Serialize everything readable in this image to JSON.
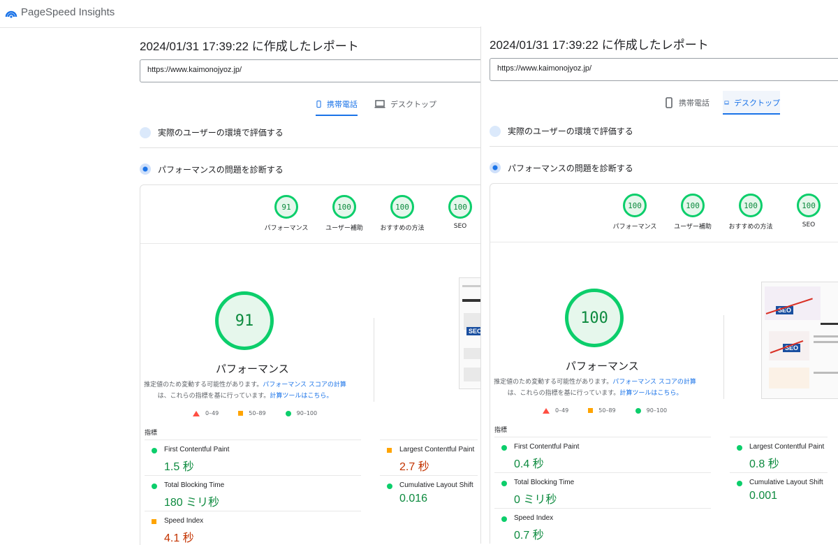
{
  "app": {
    "name": "PageSpeed Insights"
  },
  "colors": {
    "good": "#0cce6b",
    "average": "#ffa400",
    "poor": "#ff4e42",
    "accent": "#1a73e8"
  },
  "left": {
    "report_title": "2024/01/31 17:39:22 に作成したレポート",
    "url": "https://www.kaimonojyoz.jp/",
    "tabs": [
      {
        "label": "携帯電話",
        "active": true
      },
      {
        "label": "デスクトップ",
        "active": false
      }
    ],
    "sections": {
      "real_users": "実際のユーザーの環境で評価する",
      "diagnose": "パフォーマンスの問題を診断する"
    },
    "scores": [
      {
        "value": "91",
        "label": "パフォーマンス"
      },
      {
        "value": "100",
        "label": "ユーザー補助"
      },
      {
        "value": "100",
        "label": "おすすめの方法"
      },
      {
        "value": "100",
        "label": "SEO"
      }
    ],
    "main_score": "91",
    "main_label": "パフォーマンス",
    "note_line1": "推定値のため変動する可能性があります。",
    "note_link1": "パフォーマンス スコアの計算",
    "note_line2": "は、これらの指標を基に行っています。",
    "note_link2": "計算ツールはこちら。",
    "metrics_heading": "指標",
    "metrics": [
      {
        "name": "First Contentful Paint",
        "value": "1.5 秒",
        "status": "good"
      },
      {
        "name": "Largest Contentful Paint",
        "value": "2.7 秒",
        "status": "average"
      },
      {
        "name": "Total Blocking Time",
        "value": "180 ミリ秒",
        "status": "good"
      },
      {
        "name": "Cumulative Layout Shift",
        "value": "0.016",
        "status": "good"
      },
      {
        "name": "Speed Index",
        "value": "4.1 秒",
        "status": "average"
      }
    ]
  },
  "right": {
    "report_title": "2024/01/31 17:39:22 に作成したレポート",
    "url": "https://www.kaimonojyoz.jp/",
    "tabs": [
      {
        "label": "携帯電話",
        "active": false
      },
      {
        "label": "デスクトップ",
        "active": true
      }
    ],
    "sections": {
      "real_users": "実際のユーザーの環境で評価する",
      "diagnose": "パフォーマンスの問題を診断する"
    },
    "scores": [
      {
        "value": "100",
        "label": "パフォーマンス"
      },
      {
        "value": "100",
        "label": "ユーザー補助"
      },
      {
        "value": "100",
        "label": "おすすめの方法"
      },
      {
        "value": "100",
        "label": "SEO"
      }
    ],
    "main_score": "100",
    "main_label": "パフォーマンス",
    "note_line1": "推定値のため変動する可能性があります。",
    "note_link1": "パフォーマンス スコアの計算",
    "note_line2": "は、これらの指標を基に行っています。",
    "note_link2": "計算ツールはこちら。",
    "metrics_heading": "指標",
    "metrics": [
      {
        "name": "First Contentful Paint",
        "value": "0.4 秒",
        "status": "good"
      },
      {
        "name": "Largest Contentful Paint",
        "value": "0.8 秒",
        "status": "good"
      },
      {
        "name": "Total Blocking Time",
        "value": "0 ミリ秒",
        "status": "good"
      },
      {
        "name": "Cumulative Layout Shift",
        "value": "0.001",
        "status": "good"
      },
      {
        "name": "Speed Index",
        "value": "0.7 秒",
        "status": "good"
      }
    ]
  },
  "legend": [
    {
      "range": "0–49",
      "shape": "triangle"
    },
    {
      "range": "50–89",
      "shape": "square"
    },
    {
      "range": "90–100",
      "shape": "circle"
    }
  ]
}
